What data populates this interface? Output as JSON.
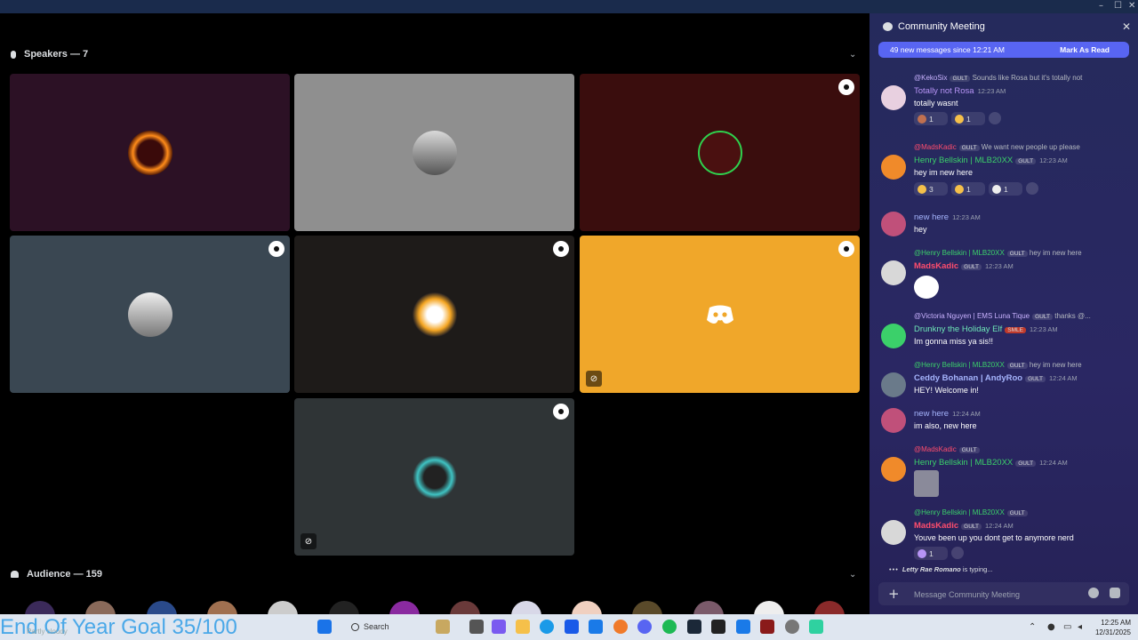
{
  "window": {
    "minimize": "–",
    "maximize": "☐",
    "close": "✕"
  },
  "stage": {
    "speakers_label": "Speakers — 7",
    "audience_label": "Audience — 159"
  },
  "overlay": {
    "goal_text": "End Of Year Goal 35/100",
    "weather_text": "Partly cloudy"
  },
  "taskbar": {
    "search_placeholder": "Search",
    "time": "12:25 AM",
    "date": "12/31/2025"
  },
  "panel": {
    "title": "Community Meeting",
    "new_messages": "49 new messages since 12:21 AM",
    "mark_read": "Mark As Read",
    "messages": [
      {
        "reply_name": "@KekoSix",
        "reply_tag": "GULT",
        "reply_text": "Sounds like Rosa but it's totally not",
        "name": "Totally not Rosa",
        "name_color": "#b794f6",
        "time": "12:23 AM",
        "text": "totally wasnt",
        "reacts": [
          {
            "emoji": "emoji-a",
            "count": "1"
          },
          {
            "emoji": "emoji-b",
            "count": "1"
          }
        ]
      },
      {
        "reply_name": "@MadsKadic",
        "reply_tag": "GULT",
        "reply_text": "We want new people up please",
        "name": "Henry Bellskin | MLB20XX",
        "name_color": "#3bd06a",
        "name_tag": "GULT",
        "time": "12:23 AM",
        "text": "hey im new here",
        "reacts": [
          {
            "emoji": "emoji-a",
            "count": "3"
          },
          {
            "emoji": "emoji-b",
            "count": "1"
          },
          {
            "emoji": "emoji-c",
            "count": "1"
          }
        ]
      },
      {
        "name": "new here",
        "name_color": "#a5b4fc",
        "time": "12:23 AM",
        "text": "hey"
      },
      {
        "reply_name": "@Henry Bellskin | MLB20XX",
        "reply_tag": "GULT",
        "reply_text": "hey im new here",
        "name": "MadsKadic",
        "name_color": "#ff4d6d",
        "name_tag": "GULT",
        "time": "12:23 AM",
        "text": ""
      },
      {
        "reply_name": "@Victoria Nguyen | EMS Luna Tique",
        "reply_tag": "GULT",
        "reply_text": "thanks @...",
        "name": "Drunkny the Holiday Elf",
        "name_color": "#6ee7b7",
        "name_tag": "SMLE",
        "time": "12:23 AM",
        "text": "Im gonna miss ya sis!!"
      },
      {
        "reply_name": "@Henry Bellskin | MLB20XX",
        "reply_tag": "GULT",
        "reply_text": "hey im new here",
        "name": "Ceddy Bohanan | AndyRoo",
        "name_color": "#a5b4fc",
        "name_tag": "GULT",
        "time": "12:24 AM",
        "text": "HEY! Welcome in!"
      },
      {
        "name": "new here",
        "name_color": "#a5b4fc",
        "time": "12:24 AM",
        "text": "im also, new here"
      },
      {
        "reply_name": "@MadsKadic",
        "reply_tag": "GULT",
        "reply_text": "",
        "name": "Henry Bellskin | MLB20XX",
        "name_color": "#3bd06a",
        "name_tag": "GULT",
        "time": "12:24 AM",
        "text": ""
      },
      {
        "reply_name": "@Henry Bellskin | MLB20XX",
        "reply_tag": "GULT",
        "reply_text": "",
        "name": "MadsKadic",
        "name_color": "#ff4d6d",
        "name_tag": "GULT",
        "time": "12:24 AM",
        "text": "Youve been up you dont get to anymore nerd",
        "reacts": [
          {
            "emoji": "emoji-heart",
            "count": "1"
          }
        ]
      }
    ],
    "typing_name": "Letty Rae Romano",
    "typing_suffix": "is typing...",
    "composer_placeholder": "Message Community Meeting"
  }
}
